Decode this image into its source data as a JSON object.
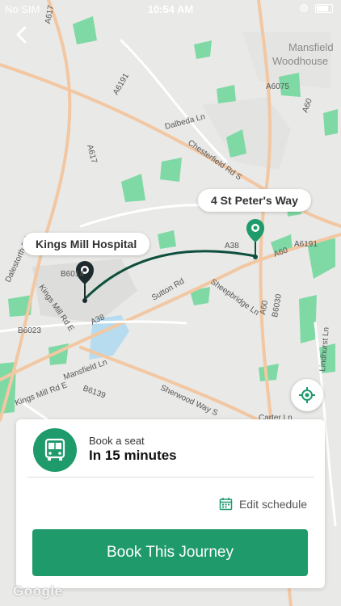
{
  "status_bar": {
    "carrier": "No SIM",
    "time": "10:54 AM"
  },
  "map": {
    "origin_label": "Kings Mill Hospital",
    "destination_label": "4 St Peter's Way",
    "place_labels": [
      "Mansfield",
      "Woodhouse"
    ],
    "road_labels": [
      "A617",
      "A6191",
      "A617",
      "A60",
      "A6075",
      "Dalbeda Ln",
      "Chesterfield Rd S",
      "A38",
      "A60",
      "A6191",
      "B6014",
      "Sutton Rd",
      "Kings Mill Rd E",
      "A38",
      "A60",
      "B6023",
      "Kings Mill Rd E",
      "Sherwood Way S",
      "B6139",
      "Dalestorth Rd",
      "Sheepbridge Ln",
      "Lindhurst Ln",
      "Carter Ln",
      "B6030",
      "Mansfield Ln"
    ],
    "attribution": "Google",
    "colors": {
      "route": "#0f4f3e",
      "origin_pin": "#1d2a2e",
      "destination_pin": "#1f9a6b",
      "park": "#7fd9a4"
    }
  },
  "booking": {
    "label": "Book a seat",
    "time": "In 15 minutes",
    "edit_label": "Edit schedule",
    "cta": "Book This Journey",
    "accent": "#1f9a6b"
  },
  "icons": {
    "back": "back-chevron-icon",
    "bus": "bus-icon",
    "calendar": "calendar-icon",
    "locate": "locate-icon"
  }
}
